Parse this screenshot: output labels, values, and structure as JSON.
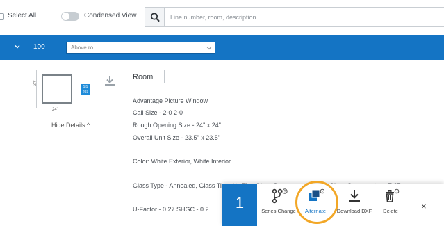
{
  "toolbar": {
    "select_all_label": "Select All",
    "condensed_view_label": "Condensed View",
    "search_placeholder": "Line number, room, description"
  },
  "line_bar": {
    "quantity": "100",
    "location_value": "Above ro"
  },
  "product": {
    "image_width_dim": "24\"",
    "image_height_dim": "24\"",
    "badge_text": "1|1 293",
    "hide_details_label": "Hide Details ^",
    "room_label": "Room",
    "details": [
      "Advantage Picture Window",
      "Call Size - 2-0 2-0",
      "Rough Opening Size - 24\" x 24\"",
      "Overall Unit Size - 23.5\" x 23.5\"",
      "Color: White Exterior, White Interior",
      "Glass Type - Annealed, Glass Tint - No Tint, Glass Spacer - ... Pattern, Glass Coating - Low-E 27",
      "U-Factor - 0.27 SHGC - 0.2"
    ]
  },
  "action_bar": {
    "selected_count": "1",
    "actions": [
      {
        "label": "Series Change",
        "icon": "series-change-icon"
      },
      {
        "label": "Alternate",
        "icon": "alternate-icon"
      },
      {
        "label": "Download DXF",
        "icon": "download-icon"
      },
      {
        "label": "Delete",
        "icon": "trash-icon"
      }
    ],
    "close_label": "×"
  },
  "colors": {
    "brand_blue": "#1474c4",
    "highlight_ring": "#f2a727"
  }
}
